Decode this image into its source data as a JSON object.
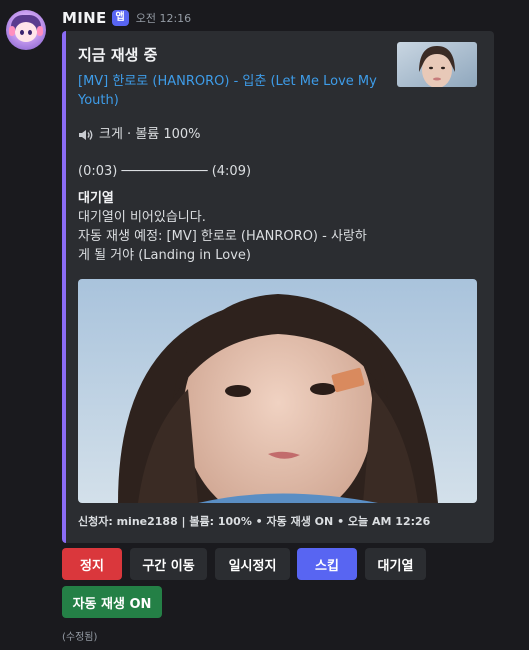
{
  "message": {
    "author": "MINE",
    "app_tag": "앱",
    "timestamp": "오전 12:16",
    "edited_label": "(수정됨)"
  },
  "embed": {
    "accent_color": "#8b6cf5",
    "title": "지금 재생 중",
    "track_link": "[MV] 한로로 (HANRORO) - 입춘 (Let Me Love My Youth)",
    "volume_line": "크게 · 볼륨 100%",
    "volume_icon": "speaker-loud-icon",
    "progress_line": "(0:03) ─────────── (4:09)",
    "queue_heading": "대기열",
    "queue_empty": "대기열이 비어있습니다.",
    "autoplay_next": "자동 재생 예정: [MV] 한로로 (HANRORO) - 사랑하게 될 거야 (Landing in Love)",
    "footer": "신청자: mine2188 | 볼륨: 100% • 자동 재생 ON • 오늘 AM 12:26"
  },
  "buttons": {
    "stop": "정지",
    "seek": "구간 이동",
    "pause": "일시정지",
    "skip": "스킵",
    "queue": "대기열",
    "autoplay": "자동 재생 ON"
  },
  "colors": {
    "stop": "#da373c",
    "skip": "#5865f2",
    "autoplay": "#248046",
    "link": "#3e9ce8"
  }
}
